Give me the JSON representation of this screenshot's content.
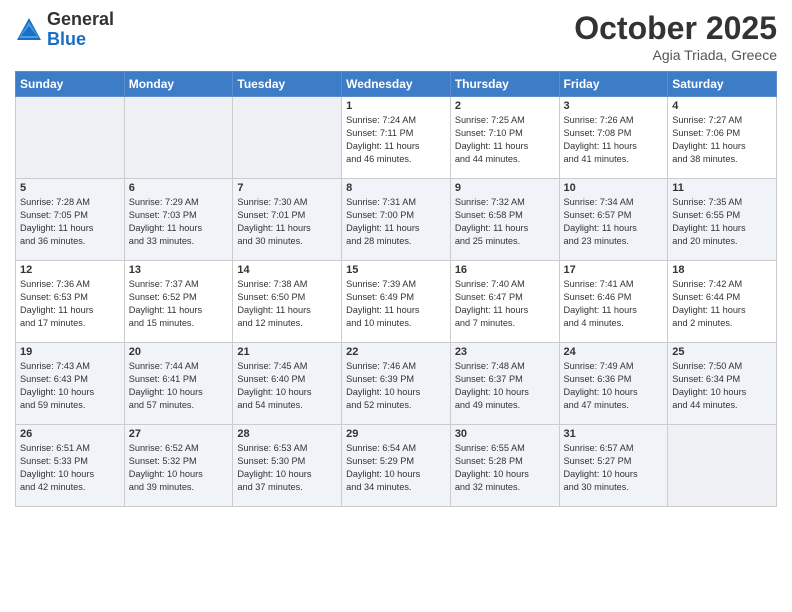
{
  "header": {
    "logo_general": "General",
    "logo_blue": "Blue",
    "month_year": "October 2025",
    "location": "Agia Triada, Greece"
  },
  "days_of_week": [
    "Sunday",
    "Monday",
    "Tuesday",
    "Wednesday",
    "Thursday",
    "Friday",
    "Saturday"
  ],
  "weeks": [
    {
      "days": [
        {
          "num": "",
          "info": ""
        },
        {
          "num": "",
          "info": ""
        },
        {
          "num": "",
          "info": ""
        },
        {
          "num": "1",
          "info": "Sunrise: 7:24 AM\nSunset: 7:11 PM\nDaylight: 11 hours\nand 46 minutes."
        },
        {
          "num": "2",
          "info": "Sunrise: 7:25 AM\nSunset: 7:10 PM\nDaylight: 11 hours\nand 44 minutes."
        },
        {
          "num": "3",
          "info": "Sunrise: 7:26 AM\nSunset: 7:08 PM\nDaylight: 11 hours\nand 41 minutes."
        },
        {
          "num": "4",
          "info": "Sunrise: 7:27 AM\nSunset: 7:06 PM\nDaylight: 11 hours\nand 38 minutes."
        }
      ]
    },
    {
      "days": [
        {
          "num": "5",
          "info": "Sunrise: 7:28 AM\nSunset: 7:05 PM\nDaylight: 11 hours\nand 36 minutes."
        },
        {
          "num": "6",
          "info": "Sunrise: 7:29 AM\nSunset: 7:03 PM\nDaylight: 11 hours\nand 33 minutes."
        },
        {
          "num": "7",
          "info": "Sunrise: 7:30 AM\nSunset: 7:01 PM\nDaylight: 11 hours\nand 30 minutes."
        },
        {
          "num": "8",
          "info": "Sunrise: 7:31 AM\nSunset: 7:00 PM\nDaylight: 11 hours\nand 28 minutes."
        },
        {
          "num": "9",
          "info": "Sunrise: 7:32 AM\nSunset: 6:58 PM\nDaylight: 11 hours\nand 25 minutes."
        },
        {
          "num": "10",
          "info": "Sunrise: 7:34 AM\nSunset: 6:57 PM\nDaylight: 11 hours\nand 23 minutes."
        },
        {
          "num": "11",
          "info": "Sunrise: 7:35 AM\nSunset: 6:55 PM\nDaylight: 11 hours\nand 20 minutes."
        }
      ]
    },
    {
      "days": [
        {
          "num": "12",
          "info": "Sunrise: 7:36 AM\nSunset: 6:53 PM\nDaylight: 11 hours\nand 17 minutes."
        },
        {
          "num": "13",
          "info": "Sunrise: 7:37 AM\nSunset: 6:52 PM\nDaylight: 11 hours\nand 15 minutes."
        },
        {
          "num": "14",
          "info": "Sunrise: 7:38 AM\nSunset: 6:50 PM\nDaylight: 11 hours\nand 12 minutes."
        },
        {
          "num": "15",
          "info": "Sunrise: 7:39 AM\nSunset: 6:49 PM\nDaylight: 11 hours\nand 10 minutes."
        },
        {
          "num": "16",
          "info": "Sunrise: 7:40 AM\nSunset: 6:47 PM\nDaylight: 11 hours\nand 7 minutes."
        },
        {
          "num": "17",
          "info": "Sunrise: 7:41 AM\nSunset: 6:46 PM\nDaylight: 11 hours\nand 4 minutes."
        },
        {
          "num": "18",
          "info": "Sunrise: 7:42 AM\nSunset: 6:44 PM\nDaylight: 11 hours\nand 2 minutes."
        }
      ]
    },
    {
      "days": [
        {
          "num": "19",
          "info": "Sunrise: 7:43 AM\nSunset: 6:43 PM\nDaylight: 10 hours\nand 59 minutes."
        },
        {
          "num": "20",
          "info": "Sunrise: 7:44 AM\nSunset: 6:41 PM\nDaylight: 10 hours\nand 57 minutes."
        },
        {
          "num": "21",
          "info": "Sunrise: 7:45 AM\nSunset: 6:40 PM\nDaylight: 10 hours\nand 54 minutes."
        },
        {
          "num": "22",
          "info": "Sunrise: 7:46 AM\nSunset: 6:39 PM\nDaylight: 10 hours\nand 52 minutes."
        },
        {
          "num": "23",
          "info": "Sunrise: 7:48 AM\nSunset: 6:37 PM\nDaylight: 10 hours\nand 49 minutes."
        },
        {
          "num": "24",
          "info": "Sunrise: 7:49 AM\nSunset: 6:36 PM\nDaylight: 10 hours\nand 47 minutes."
        },
        {
          "num": "25",
          "info": "Sunrise: 7:50 AM\nSunset: 6:34 PM\nDaylight: 10 hours\nand 44 minutes."
        }
      ]
    },
    {
      "days": [
        {
          "num": "26",
          "info": "Sunrise: 6:51 AM\nSunset: 5:33 PM\nDaylight: 10 hours\nand 42 minutes."
        },
        {
          "num": "27",
          "info": "Sunrise: 6:52 AM\nSunset: 5:32 PM\nDaylight: 10 hours\nand 39 minutes."
        },
        {
          "num": "28",
          "info": "Sunrise: 6:53 AM\nSunset: 5:30 PM\nDaylight: 10 hours\nand 37 minutes."
        },
        {
          "num": "29",
          "info": "Sunrise: 6:54 AM\nSunset: 5:29 PM\nDaylight: 10 hours\nand 34 minutes."
        },
        {
          "num": "30",
          "info": "Sunrise: 6:55 AM\nSunset: 5:28 PM\nDaylight: 10 hours\nand 32 minutes."
        },
        {
          "num": "31",
          "info": "Sunrise: 6:57 AM\nSunset: 5:27 PM\nDaylight: 10 hours\nand 30 minutes."
        },
        {
          "num": "",
          "info": ""
        }
      ]
    }
  ]
}
